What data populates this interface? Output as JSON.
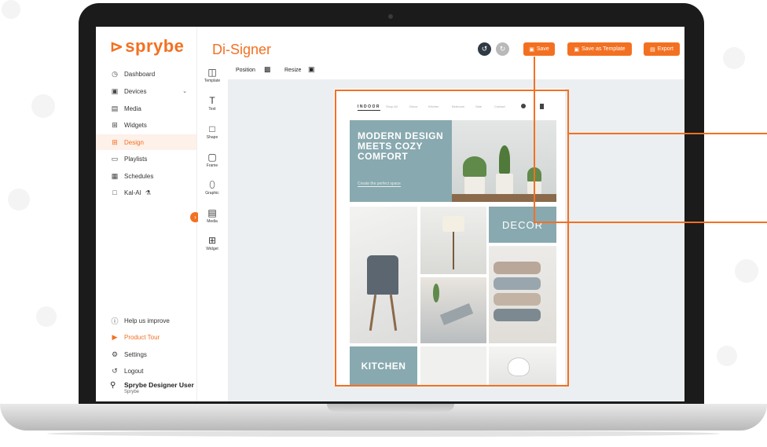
{
  "app": {
    "brand": "sprybe",
    "title": "Di-Signer"
  },
  "sidebar": {
    "items": [
      {
        "label": "Dashboard",
        "icon": "dashboard-icon"
      },
      {
        "label": "Devices",
        "icon": "devices-icon"
      },
      {
        "label": "Media",
        "icon": "media-icon"
      },
      {
        "label": "Widgets",
        "icon": "widgets-icon"
      },
      {
        "label": "Design",
        "icon": "design-icon",
        "active": true
      },
      {
        "label": "Playlists",
        "icon": "playlists-icon"
      },
      {
        "label": "Schedules",
        "icon": "schedules-icon"
      },
      {
        "label": "Kal-AI",
        "icon": "ai-icon"
      }
    ],
    "bottom_items": [
      {
        "label": "Help us improve",
        "icon": "help-icon"
      },
      {
        "label": "Product Tour",
        "icon": "tour-icon"
      },
      {
        "label": "Settings",
        "icon": "settings-icon"
      },
      {
        "label": "Logout",
        "icon": "logout-icon"
      }
    ],
    "user": {
      "name": "Sprybe Designer User",
      "org": "Sprybe"
    }
  },
  "tools": [
    {
      "label": "Template",
      "icon": "template-icon"
    },
    {
      "label": "Text",
      "icon": "text-icon"
    },
    {
      "label": "Shape",
      "icon": "shape-icon"
    },
    {
      "label": "Frame",
      "icon": "frame-icon"
    },
    {
      "label": "Graphic",
      "icon": "graphic-icon"
    },
    {
      "label": "Media",
      "icon": "media-icon"
    },
    {
      "label": "Widget",
      "icon": "widget-icon"
    }
  ],
  "header": {
    "save_label": "Save",
    "save_template_label": "Save as Template",
    "export_label": "Export"
  },
  "toolbar": {
    "position_label": "Position",
    "resize_label": "Resize"
  },
  "design": {
    "logo": "INDOOR",
    "nav": [
      "Shop All",
      "Decor",
      "Kitchen",
      "Bedroom",
      "Sale",
      "Contact"
    ],
    "hero_title": "MODERN DESIGN MEETS COZY COMFORT",
    "hero_sub": "Create the perfect space",
    "decor_label": "DECOR",
    "kitchen_label": "KITCHEN"
  },
  "colors": {
    "accent": "#f37021",
    "tile": "#88a9af"
  }
}
